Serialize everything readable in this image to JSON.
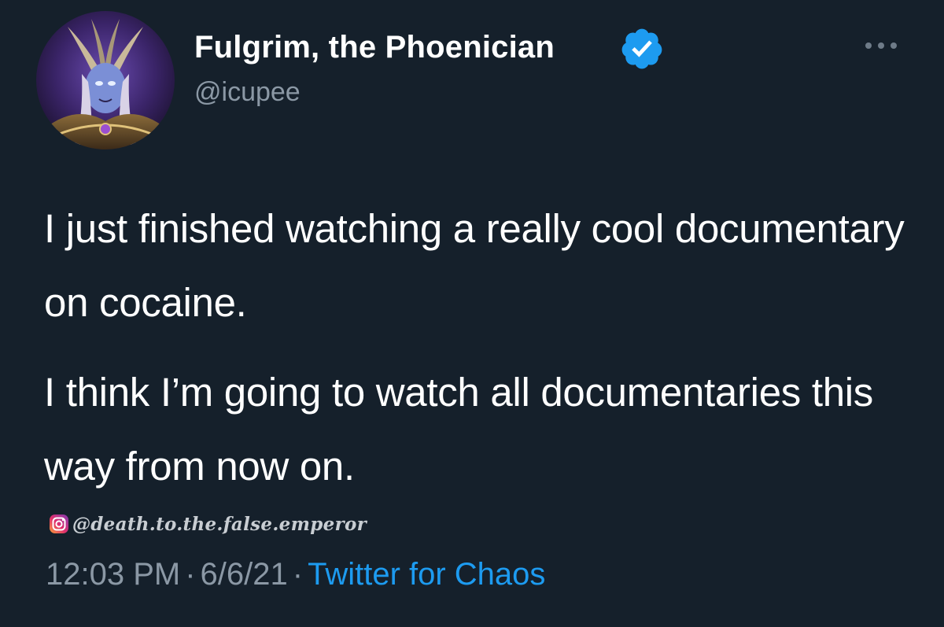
{
  "author": {
    "display_name": "Fulgrim, the Phoenician",
    "handle": "@icupee",
    "verified": true,
    "avatar_icon": "avatar-image"
  },
  "tweet": {
    "paragraphs": [
      "I just finished watching a really cool documentary on cocaine.",
      "I think I’m going to watch all documentaries this way from now on."
    ],
    "time": "12:03 PM",
    "date": "6/6/21",
    "separator": "·",
    "source": "Twitter for Chaos"
  },
  "watermark": {
    "icon": "instagram-icon",
    "text": "@death.to.the.false.emperor"
  },
  "icons": {
    "more": "more-icon",
    "verified": "verified-badge-icon"
  },
  "colors": {
    "background": "#15202b",
    "text": "#ffffff",
    "secondary": "#8b98a5",
    "link": "#1d9bf0",
    "verified": "#1d9bf0"
  }
}
